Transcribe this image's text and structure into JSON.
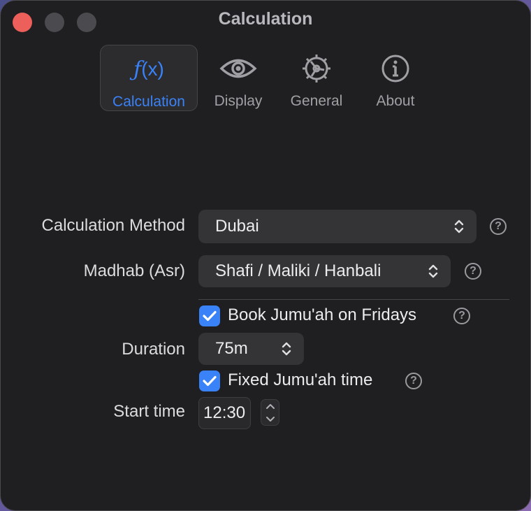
{
  "window": {
    "title": "Calculation"
  },
  "tabs": [
    {
      "label": "Calculation",
      "icon": "function-icon",
      "active": true
    },
    {
      "label": "Display",
      "icon": "eye-icon",
      "active": false
    },
    {
      "label": "General",
      "icon": "gear-icon",
      "active": false
    },
    {
      "label": "About",
      "icon": "info-icon",
      "active": false
    }
  ],
  "form": {
    "calculation_method": {
      "label": "Calculation Method",
      "value": "Dubai",
      "help": "?"
    },
    "madhab": {
      "label": "Madhab (Asr)",
      "value": "Shafi / Maliki / Hanbali",
      "help": "?"
    },
    "book_jumuah": {
      "label": "Book Jumu'ah on Fridays",
      "checked": true,
      "help": "?"
    },
    "duration": {
      "label": "Duration",
      "value": "75m"
    },
    "fixed_jumuah": {
      "label": "Fixed Jumu'ah time",
      "checked": true,
      "help": "?"
    },
    "start_time": {
      "label": "Start time",
      "value": "12:30"
    }
  },
  "colors": {
    "accent": "#3a82f7",
    "close": "#ed5f5a",
    "background": "#1f1f22"
  }
}
